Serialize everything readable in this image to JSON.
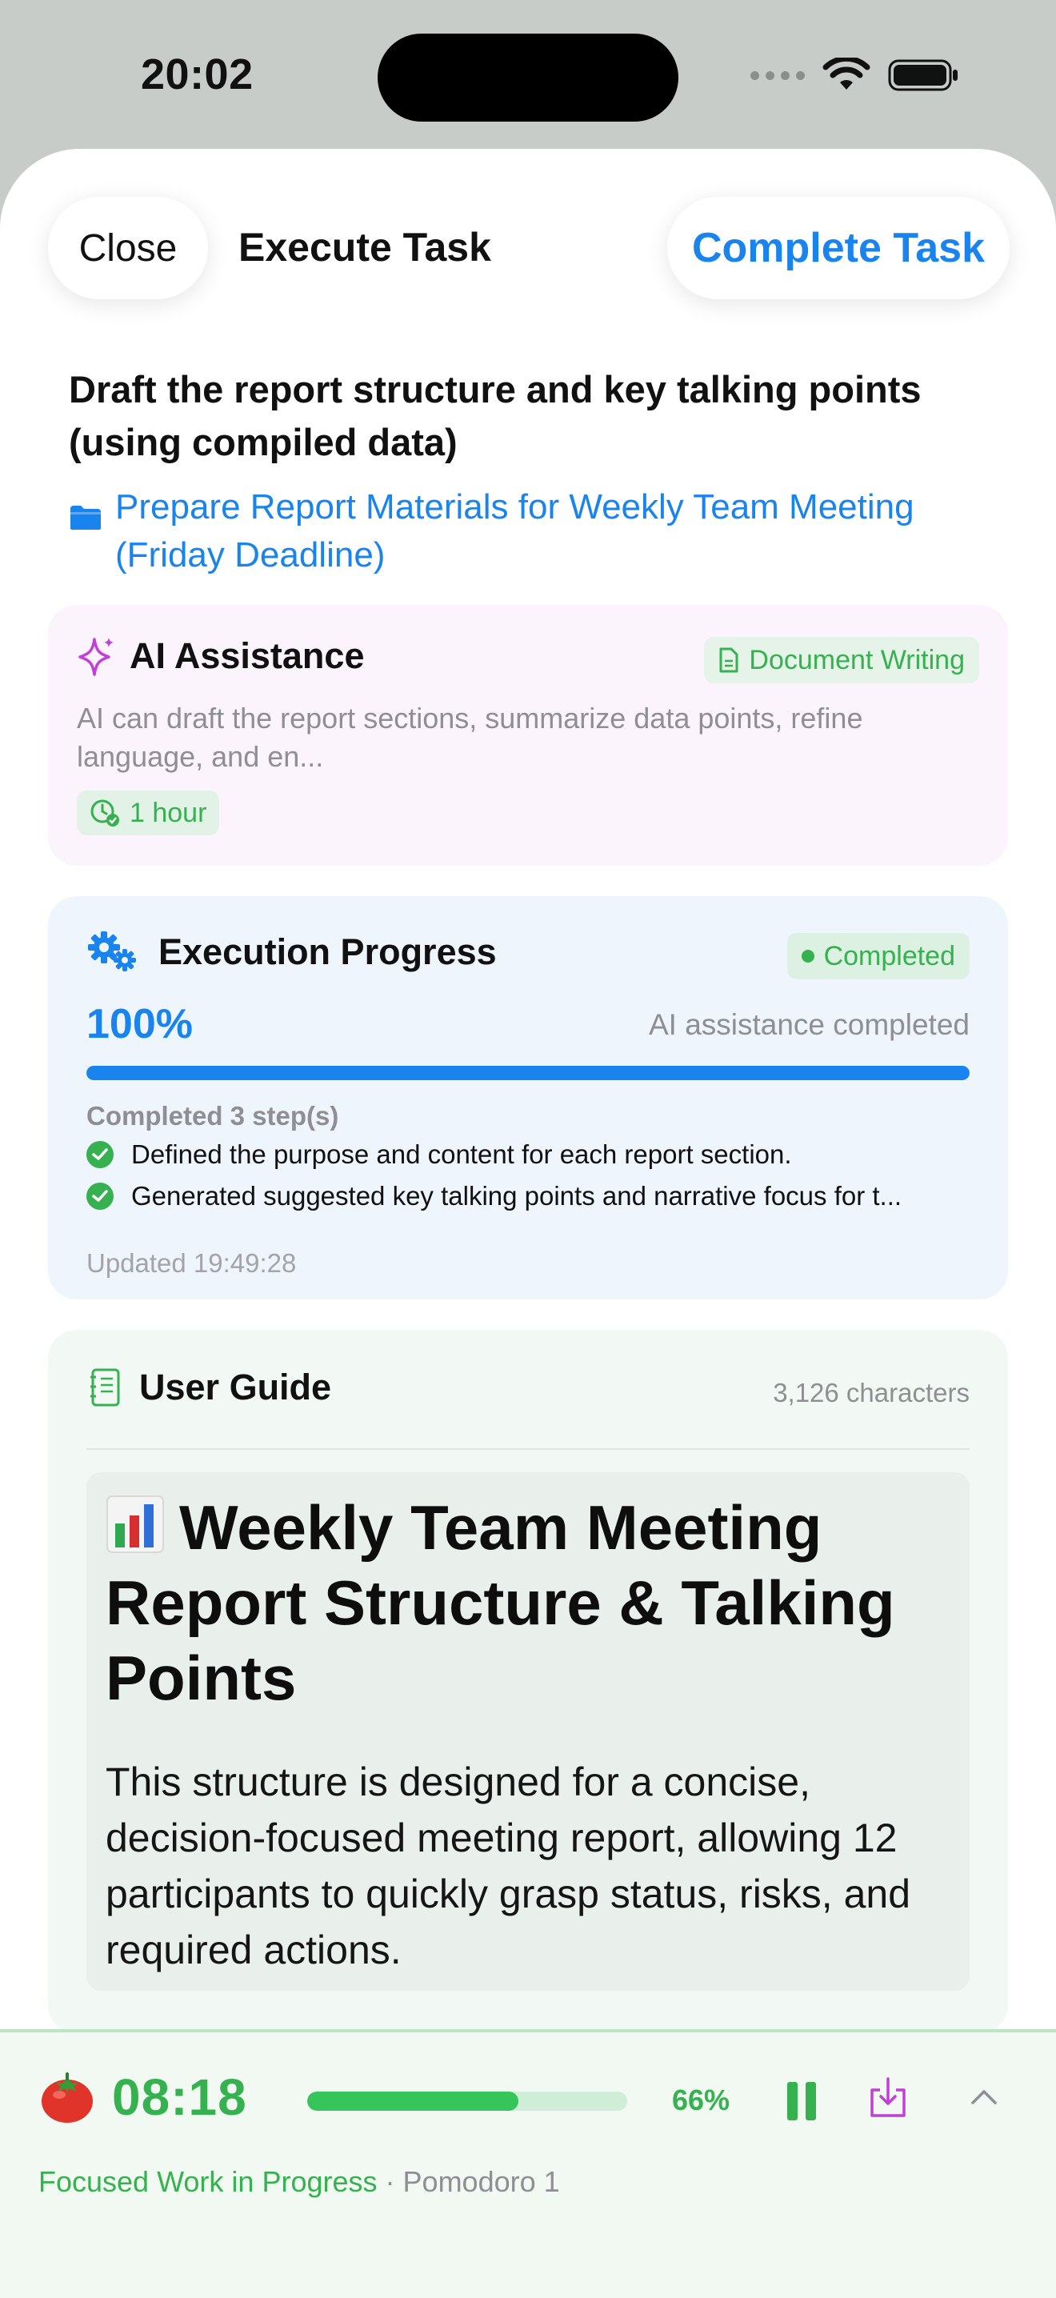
{
  "status_bar": {
    "time": "20:02"
  },
  "header": {
    "close_label": "Close",
    "title": "Execute Task",
    "complete_label": "Complete Task"
  },
  "task": {
    "title": "Draft the report structure and key talking points (using compiled data)",
    "parent": "Prepare Report Materials for Weekly Team Meeting (Friday Deadline)"
  },
  "ai_card": {
    "label": "AI Assistance",
    "category": "Document Writing",
    "description": "AI can draft the report sections, summarize data points, refine language, and en...",
    "duration": "1 hour"
  },
  "progress_card": {
    "label": "Execution Progress",
    "status": "Completed",
    "percent_text": "100%",
    "percent_value": 1.0,
    "note": "AI assistance completed",
    "steps_heading": "Completed 3 step(s)",
    "steps": [
      "Defined the purpose and content for each report section.",
      "Generated suggested key talking points and narrative focus for t..."
    ],
    "updated": "Updated 19:49:28"
  },
  "guide_card": {
    "label": "User Guide",
    "char_count": "3,126 characters",
    "heading": "Weekly Team Meeting Report Structure & Talking Points",
    "paragraph": "This structure is designed for a concise, decision-focused meeting report, allowing 12 participants to quickly grasp status, risks, and required actions."
  },
  "pomodoro": {
    "timer": "08:18",
    "progress_value": 0.66,
    "percent_text": "66%",
    "status": "Focused Work in Progress",
    "separator": "·",
    "count": "Pomodoro 1"
  },
  "colors": {
    "accent_blue": "#1a84ee",
    "success_green": "#36b14f",
    "ai_purple": "#c13fd6"
  },
  "icons": [
    "wifi-icon",
    "battery-icon",
    "folder-icon",
    "sparkle-icon",
    "document-icon",
    "clock-check-icon",
    "gears-icon",
    "check-circle-icon",
    "notebook-icon",
    "bar-chart-icon",
    "tomato-icon",
    "pause-icon",
    "save-tray-icon",
    "chevron-up-icon"
  ]
}
